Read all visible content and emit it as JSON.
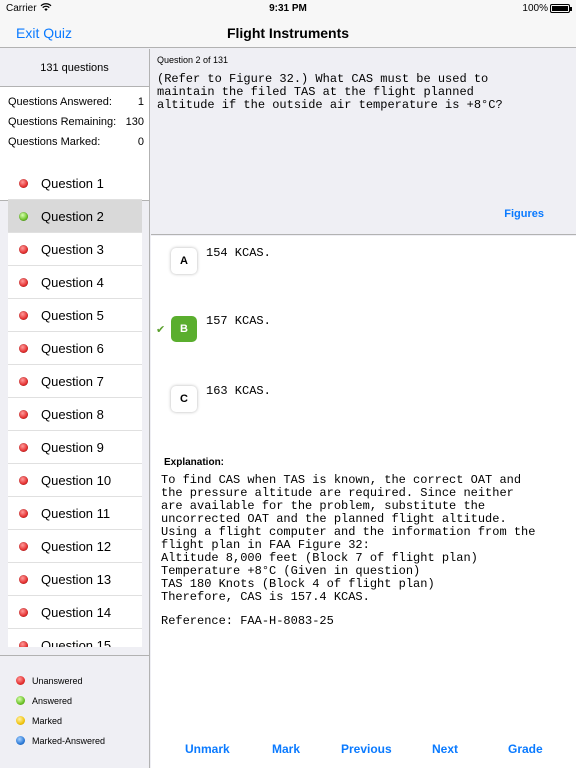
{
  "status": {
    "carrier": "Carrier",
    "time": "9:31 PM",
    "battery": "100%"
  },
  "nav": {
    "exit_label": "Exit Quiz",
    "title": "Flight Instruments"
  },
  "sidebar": {
    "count_label": "131 questions",
    "stats": [
      {
        "label": "Questions Answered:",
        "value": "1"
      },
      {
        "label": "Questions Remaining:",
        "value": "130"
      },
      {
        "label": "Questions Marked:",
        "value": "0"
      }
    ],
    "questions": [
      {
        "label": "Question 1",
        "status": "red"
      },
      {
        "label": "Question 2",
        "status": "green",
        "selected": true
      },
      {
        "label": "Question 3",
        "status": "red"
      },
      {
        "label": "Question 4",
        "status": "red"
      },
      {
        "label": "Question 5",
        "status": "red"
      },
      {
        "label": "Question 6",
        "status": "red"
      },
      {
        "label": "Question 7",
        "status": "red"
      },
      {
        "label": "Question 8",
        "status": "red"
      },
      {
        "label": "Question 9",
        "status": "red"
      },
      {
        "label": "Question 10",
        "status": "red"
      },
      {
        "label": "Question 11",
        "status": "red"
      },
      {
        "label": "Question 12",
        "status": "red"
      },
      {
        "label": "Question 13",
        "status": "red"
      },
      {
        "label": "Question 14",
        "status": "red"
      },
      {
        "label": "Question 15",
        "status": "red"
      }
    ],
    "legend": [
      {
        "label": "Unanswered",
        "color": "red"
      },
      {
        "label": "Answered",
        "color": "green"
      },
      {
        "label": "Marked",
        "color": "yellow"
      },
      {
        "label": "Marked-Answered",
        "color": "blue"
      }
    ]
  },
  "question": {
    "number_label": "Question 2 of 131",
    "text": "(Refer to Figure 32.) What CAS must be used to\nmaintain the filed TAS at the flight planned\naltitude if the outside air temperature is +8°C?",
    "figures_label": "Figures"
  },
  "answers": [
    {
      "letter": "A",
      "text": "154 KCAS.",
      "correct": false
    },
    {
      "letter": "B",
      "text": "157 KCAS.",
      "correct": true,
      "check": "✔"
    },
    {
      "letter": "C",
      "text": "163 KCAS.",
      "correct": false
    }
  ],
  "explanation": {
    "title": "Explanation:",
    "text": "To find CAS when TAS is known, the correct OAT and\nthe pressure altitude are required. Since neither\nare available for the problem, substitute the\nuncorrected OAT and the planned flight altitude.\nUsing a flight computer and the information from the\nflight plan in FAA Figure 32:\nAltitude 8,000 feet (Block 7 of flight plan)\nTemperature +8°C (Given in question)\nTAS 180 Knots (Block 4 of flight plan)\nTherefore, CAS is 157.4 KCAS.",
    "reference": "Reference: FAA-H-8083-25"
  },
  "toolbar": {
    "unmark": "Unmark",
    "mark": "Mark",
    "previous": "Previous",
    "next": "Next",
    "grade": "Grade"
  }
}
